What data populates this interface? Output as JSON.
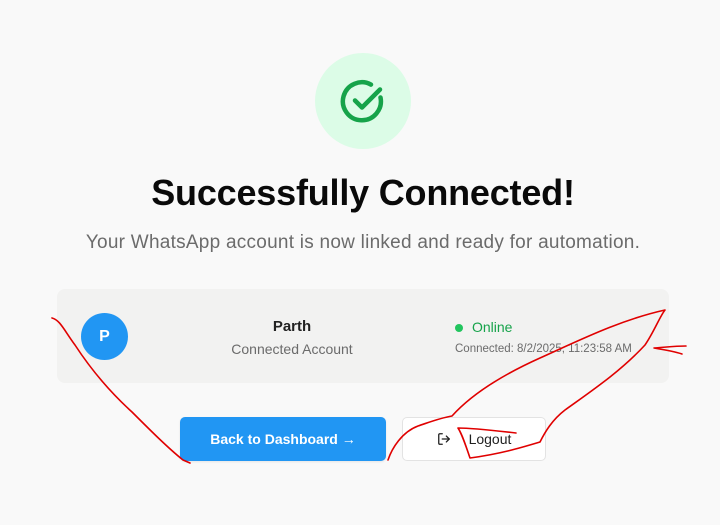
{
  "success": {
    "icon": "check-circle-icon",
    "accent_color": "#16a34a",
    "badge_color": "#dcfce7"
  },
  "title": "Successfully Connected!",
  "subtitle": "Your WhatsApp account is now linked and ready for automation.",
  "account": {
    "avatar_initial": "P",
    "name": "Parth",
    "label": "Connected Account",
    "status": "Online",
    "status_color": "#22c55e",
    "connected_time": "Connected: 8/2/2025, 11:23:58 AM"
  },
  "actions": {
    "dashboard_label": "Back to Dashboard →",
    "logout_label": "Logout",
    "logout_icon": "logout-icon",
    "primary_color": "#2196f3"
  },
  "annotation_color": "#e00000"
}
